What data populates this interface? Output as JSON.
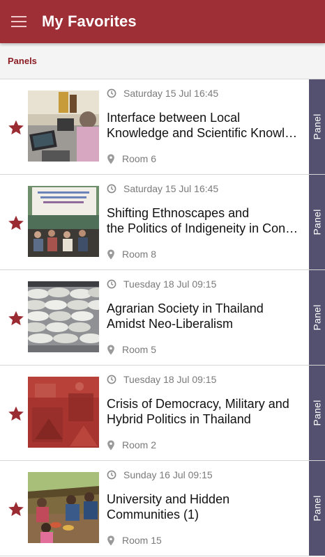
{
  "appbar": {
    "title": "My Favorites",
    "menu_icon": "hamburger-icon",
    "color": "#9e2f36"
  },
  "section": {
    "label": "Panels"
  },
  "items": [
    {
      "time": "Saturday 15 Jul 16:45",
      "title_line1": "Interface between Local",
      "title_line2": "Knowledge and Scientific Knowl…",
      "room": "Room 6",
      "tag": "Panel"
    },
    {
      "time": "Saturday 15 Jul 16:45",
      "title_line1": "Shifting Ethnoscapes and",
      "title_line2": "the Politics of Indigeneity in Con…",
      "room": "Room 8",
      "tag": "Panel"
    },
    {
      "time": "Tuesday 18 Jul 09:15",
      "title_line1": "Agrarian Society in Thailand",
      "title_line2": "Amidst Neo-Liberalism",
      "room": "Room 5",
      "tag": "Panel"
    },
    {
      "time": "Tuesday 18 Jul 09:15",
      "title_line1": "Crisis of Democracy, Military and",
      "title_line2": "Hybrid Politics in Thailand",
      "room": "Room 2",
      "tag": "Panel"
    },
    {
      "time": "Sunday 16 Jul 09:15",
      "title_line1": "University and Hidden",
      "title_line2": "Communities (1)",
      "room": "Room 15",
      "tag": "Panel"
    }
  ],
  "colors": {
    "accent": "#9e2f36",
    "star": "#9a2b33",
    "tag": "#54506f",
    "meta_text": "#7a7a7a"
  }
}
